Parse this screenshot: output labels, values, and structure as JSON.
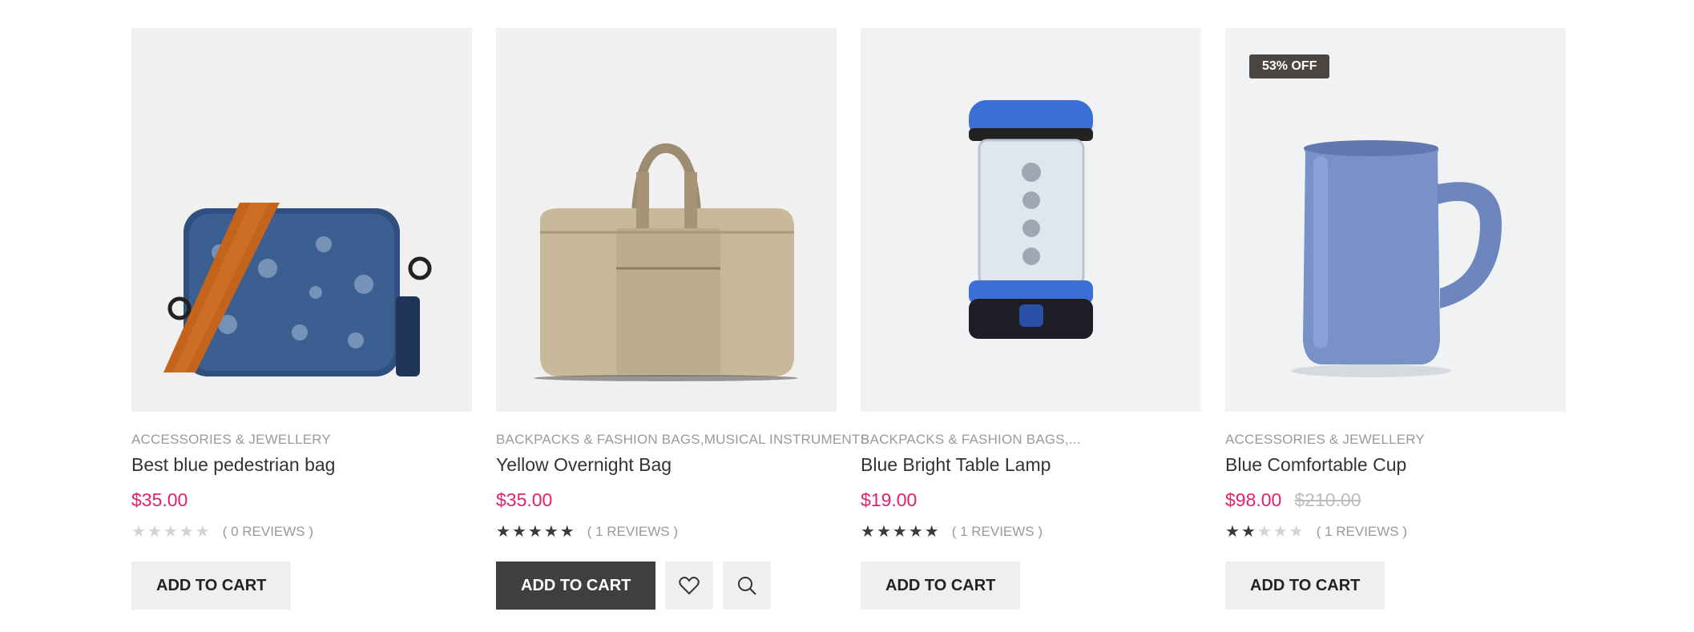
{
  "products": [
    {
      "category": "ACCESSORIES & JEWELLERY",
      "title": "Best blue pedestrian bag",
      "price": "$35.00",
      "old_price": "",
      "rating": 0,
      "reviews": "( 0 REVIEWS )",
      "cart_label": "ADD TO CART",
      "image_icon": "crossbody-bag-image"
    },
    {
      "category": "BACKPACKS & FASHION BAGS,MUSICAL INSTRUMENTS",
      "title": "Yellow Overnight Bag",
      "price": "$35.00",
      "old_price": "",
      "rating": 5,
      "reviews": "( 1 REVIEWS )",
      "cart_label": "ADD TO CART",
      "image_icon": "duffel-bag-image"
    },
    {
      "category": "BACKPACKS & FASHION BAGS,...",
      "title": "Blue Bright Table Lamp",
      "price": "$19.00",
      "old_price": "",
      "rating": 5,
      "reviews": "( 1 REVIEWS )",
      "cart_label": "ADD TO CART",
      "image_icon": "lantern-image"
    },
    {
      "badge": "53% OFF",
      "category": "ACCESSORIES & JEWELLERY",
      "title": "Blue Comfortable Cup",
      "price": "$98.00",
      "old_price": "$210.00",
      "rating": 2,
      "reviews": "( 1 REVIEWS )",
      "cart_label": "ADD TO CART",
      "image_icon": "mug-image"
    }
  ],
  "colors": {
    "price": "#e2216c",
    "button_dark": "#3f3f3f",
    "button_light": "#efefef",
    "badge": "#4a4540"
  },
  "icons": [
    "heart-icon",
    "search-icon",
    "star-icon"
  ]
}
